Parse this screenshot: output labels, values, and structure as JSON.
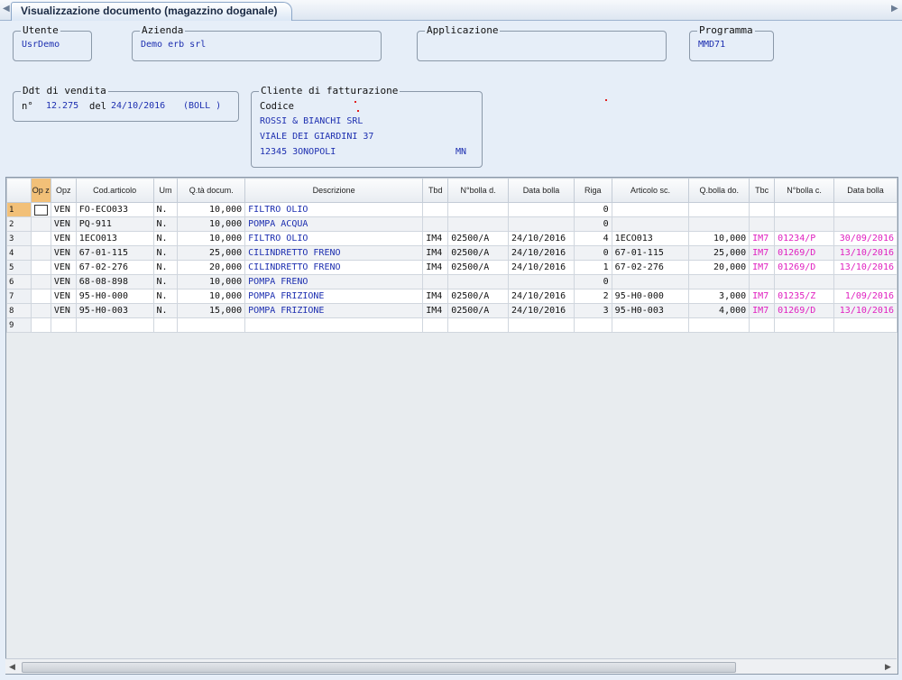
{
  "window": {
    "tab_title": "Visualizzazione documento (magazzino doganale)"
  },
  "fields": {
    "utente": {
      "label": "Utente",
      "value": "UsrDemo"
    },
    "azienda": {
      "label": "Azienda",
      "value": "Demo erb srl"
    },
    "applicazione": {
      "label": "Applicazione",
      "value": ""
    },
    "programma": {
      "label": "Programma",
      "value": "MMD71"
    }
  },
  "ddt": {
    "label": "Ddt di vendita",
    "n_label": "n°",
    "number": "12.275",
    "del_label": "del",
    "date": "24/10/2016",
    "type": "(BOLL )"
  },
  "cliente": {
    "label": "Cliente di fatturazione",
    "codice_label": "Codice",
    "name": "ROSSI & BIANCHI SRL",
    "address": "VIALE DEI GIARDINI 37",
    "city": "12345 3ONOPOLI",
    "province": "MN"
  },
  "grid": {
    "headers": {
      "opz_sel": "Op z",
      "opz": "Opz",
      "cod": "Cod.articolo",
      "um": "Um",
      "qta": "Q.tà docum.",
      "desc": "Descrizione",
      "tbd": "Tbd",
      "nbolla_d": "N°bolla d.",
      "data_bolla": "Data bolla",
      "riga": "Riga",
      "art_sc": "Articolo sc.",
      "qbolla_do": "Q.bolla do.",
      "tbc": "Tbc",
      "nbolla_c": "N°bolla c.",
      "data_bolla_c": "Data bolla"
    },
    "rows": [
      {
        "n": "1",
        "opz": "VEN",
        "cod": "FO-ECO033",
        "um": "N.",
        "qta": "10,000",
        "desc": "FILTRO OLIO",
        "tbd": "",
        "nbd": "",
        "dbd": "",
        "riga": "0",
        "art_sc": "",
        "qbo": "",
        "tbc": "",
        "nbc": "",
        "dbc": ""
      },
      {
        "n": "2",
        "opz": "VEN",
        "cod": "PQ-911",
        "um": "N.",
        "qta": "10,000",
        "desc": "POMPA ACQUA",
        "tbd": "",
        "nbd": "",
        "dbd": "",
        "riga": "0",
        "art_sc": "",
        "qbo": "",
        "tbc": "",
        "nbc": "",
        "dbc": ""
      },
      {
        "n": "3",
        "opz": "VEN",
        "cod": "1ECO013",
        "um": "N.",
        "qta": "10,000",
        "desc": "FILTRO OLIO",
        "tbd": "IM4",
        "nbd": "02500/A",
        "dbd": "24/10/2016",
        "riga": "4",
        "art_sc": "1ECO013",
        "qbo": "10,000",
        "tbc": "IM7",
        "nbc": "01234/P",
        "dbc": "30/09/2016"
      },
      {
        "n": "4",
        "opz": "VEN",
        "cod": "67-01-115",
        "um": "N.",
        "qta": "25,000",
        "desc": "CILINDRETTO FRENO",
        "tbd": "IM4",
        "nbd": "02500/A",
        "dbd": "24/10/2016",
        "riga": "0",
        "art_sc": "67-01-115",
        "qbo": "25,000",
        "tbc": "IM7",
        "nbc": "01269/D",
        "dbc": "13/10/2016"
      },
      {
        "n": "5",
        "opz": "VEN",
        "cod": "67-02-276",
        "um": "N.",
        "qta": "20,000",
        "desc": "CILINDRETTO FRENO",
        "tbd": "IM4",
        "nbd": "02500/A",
        "dbd": "24/10/2016",
        "riga": "1",
        "art_sc": "67-02-276",
        "qbo": "20,000",
        "tbc": "IM7",
        "nbc": "01269/D",
        "dbc": "13/10/2016"
      },
      {
        "n": "6",
        "opz": "VEN",
        "cod": "68-08-898",
        "um": "N.",
        "qta": "10,000",
        "desc": "POMPA FRENO",
        "tbd": "",
        "nbd": "",
        "dbd": "",
        "riga": "0",
        "art_sc": "",
        "qbo": "",
        "tbc": "",
        "nbc": "",
        "dbc": ""
      },
      {
        "n": "7",
        "opz": "VEN",
        "cod": "95-H0-000",
        "um": "N.",
        "qta": "10,000",
        "desc": "POMPA FRIZIONE",
        "tbd": "IM4",
        "nbd": "02500/A",
        "dbd": "24/10/2016",
        "riga": "2",
        "art_sc": "95-H0-000",
        "qbo": "3,000",
        "tbc": "IM7",
        "nbc": "01235/Z",
        "dbc": "1/09/2016"
      },
      {
        "n": "8",
        "opz": "VEN",
        "cod": "95-H0-003",
        "um": "N.",
        "qta": "15,000",
        "desc": "POMPA FRIZIONE",
        "tbd": "IM4",
        "nbd": "02500/A",
        "dbd": "24/10/2016",
        "riga": "3",
        "art_sc": "95-H0-003",
        "qbo": "4,000",
        "tbc": "IM7",
        "nbc": "01269/D",
        "dbc": "13/10/2016"
      },
      {
        "n": "9",
        "opz": "",
        "cod": "",
        "um": "",
        "qta": "",
        "desc": "",
        "tbd": "",
        "nbd": "",
        "dbd": "",
        "riga": "",
        "art_sc": "",
        "qbo": "",
        "tbc": "",
        "nbc": "",
        "dbc": ""
      }
    ]
  },
  "icons": {
    "tab_scroll_left": "triangle-left-icon",
    "tab_scroll_right": "triangle-right-icon",
    "hscroll_left": "scroll-left-icon",
    "hscroll_right": "scroll-right-icon"
  },
  "colors": {
    "value_text": "#1d2fb0",
    "bolla_c_text": "#e020c0",
    "selected_header": "#f2c078",
    "background": "#e6eef8"
  }
}
